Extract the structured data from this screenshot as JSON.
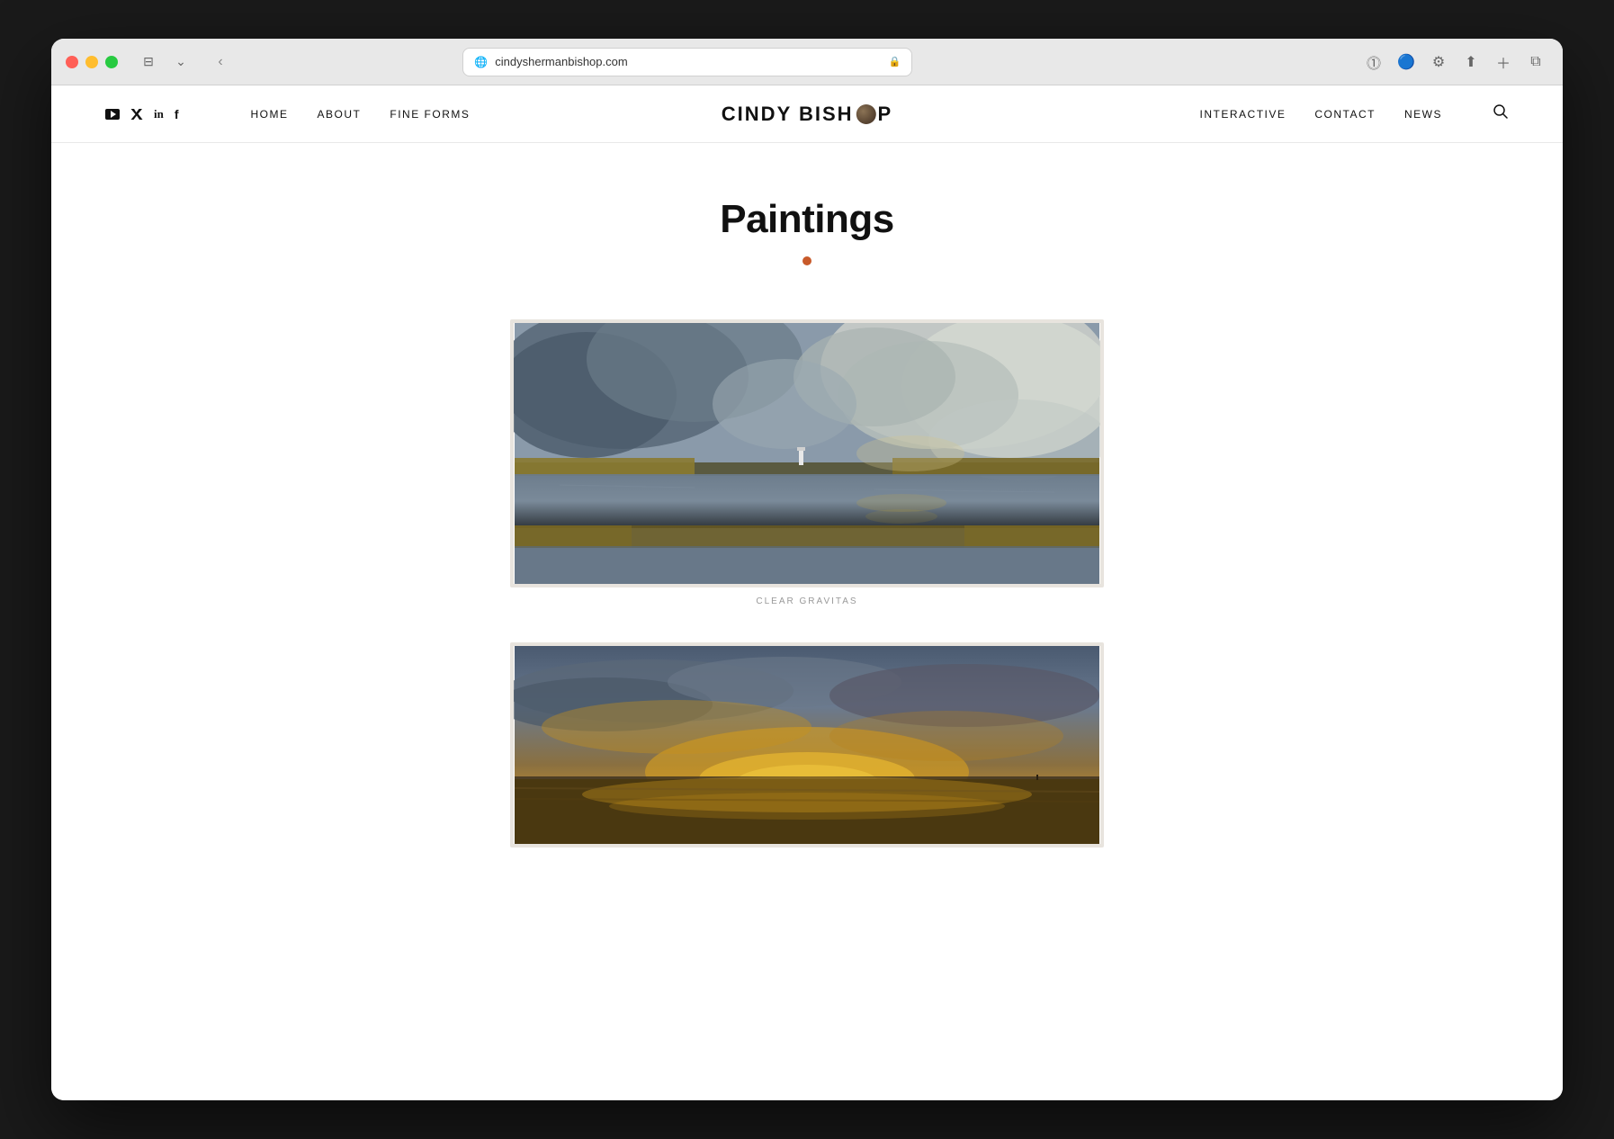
{
  "browser": {
    "url": "cindyshermanbishop.com",
    "lock_icon": "🔒",
    "extensions_btn": "⊞"
  },
  "header": {
    "social_icons": [
      {
        "name": "youtube-icon",
        "symbol": "▶",
        "label": "YouTube"
      },
      {
        "name": "twitter-icon",
        "symbol": "𝕏",
        "label": "Twitter"
      },
      {
        "name": "linkedin-icon",
        "symbol": "in",
        "label": "LinkedIn"
      },
      {
        "name": "facebook-icon",
        "symbol": "f",
        "label": "Facebook"
      }
    ],
    "nav_left": [
      {
        "label": "HOME",
        "key": "home"
      },
      {
        "label": "ABOUT",
        "key": "about"
      },
      {
        "label": "FINE FORMS",
        "key": "fine-forms"
      }
    ],
    "logo_text_before": "CINDY BISH",
    "logo_text_after": "P",
    "nav_right": [
      {
        "label": "INTERACTIVE",
        "key": "interactive"
      },
      {
        "label": "CONTACT",
        "key": "contact"
      },
      {
        "label": "NEWS",
        "key": "news"
      }
    ]
  },
  "page": {
    "title": "Paintings",
    "accent_color": "#c85a2a"
  },
  "paintings": [
    {
      "id": 1,
      "caption": "CLEAR GRAVITAS",
      "alt": "Stormy marsh landscape with lighthouse"
    },
    {
      "id": 2,
      "caption": "",
      "alt": "Sunset beach landscape"
    }
  ]
}
